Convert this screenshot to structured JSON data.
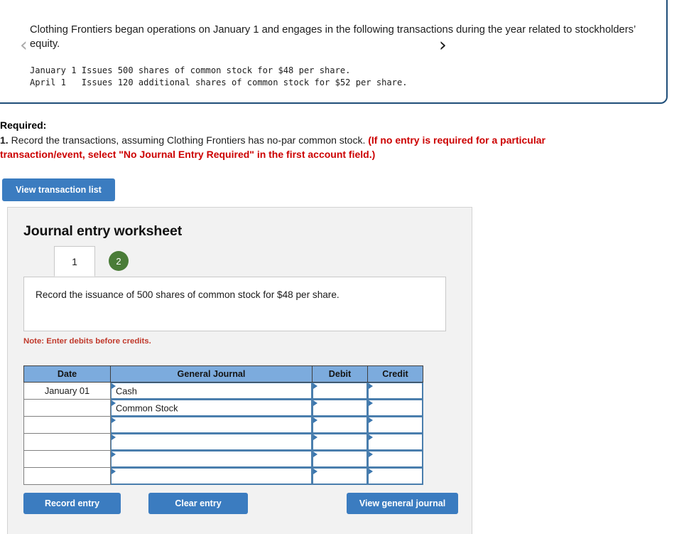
{
  "problem": {
    "paragraph": "Clothing Frontiers began operations on January 1 and engages in the following transactions during the year related to stockholders’ equity.",
    "transactions": "January 1 Issues 500 shares of common stock for $48 per share.\nApril 1   Issues 120 additional shares of common stock for $52 per share."
  },
  "required": {
    "label": "Required:",
    "number": "1.",
    "statement": " Record the transactions, assuming Clothing Frontiers has no-par common stock. ",
    "note_red": "(If no entry is required for a particular transaction/event, select \"No Journal Entry Required\" in the first account field.)"
  },
  "buttons": {
    "view_transaction_list": "View transaction list",
    "record_entry": "Record entry",
    "clear_entry": "Clear entry",
    "view_general_journal": "View general journal"
  },
  "worksheet": {
    "title": "Journal entry worksheet",
    "nav": {
      "prev_icon": "‹",
      "next_icon": "›"
    },
    "tabs": [
      {
        "label": "1",
        "state": "active"
      },
      {
        "label": "2",
        "state": "badge"
      }
    ],
    "description": "Record the issuance of 500 shares of common stock for $48 per share.",
    "note": "Note: Enter debits before credits.",
    "table": {
      "headers": [
        "Date",
        "General Journal",
        "Debit",
        "Credit"
      ],
      "rows": [
        {
          "date": "January 01",
          "account": "Cash",
          "debit": "",
          "credit": ""
        },
        {
          "date": "",
          "account": "Common Stock",
          "debit": "",
          "credit": ""
        },
        {
          "date": "",
          "account": "",
          "debit": "",
          "credit": ""
        },
        {
          "date": "",
          "account": "",
          "debit": "",
          "credit": ""
        },
        {
          "date": "",
          "account": "",
          "debit": "",
          "credit": ""
        },
        {
          "date": "",
          "account": "",
          "debit": "",
          "credit": ""
        }
      ]
    }
  },
  "colors": {
    "button_blue": "#3b7cc0",
    "header_blue": "#7cabdd",
    "panel_border_navy": "#1f4e79",
    "note_red": "#c0392b",
    "required_red": "#cc0000",
    "badge_green": "#4a7c38"
  }
}
